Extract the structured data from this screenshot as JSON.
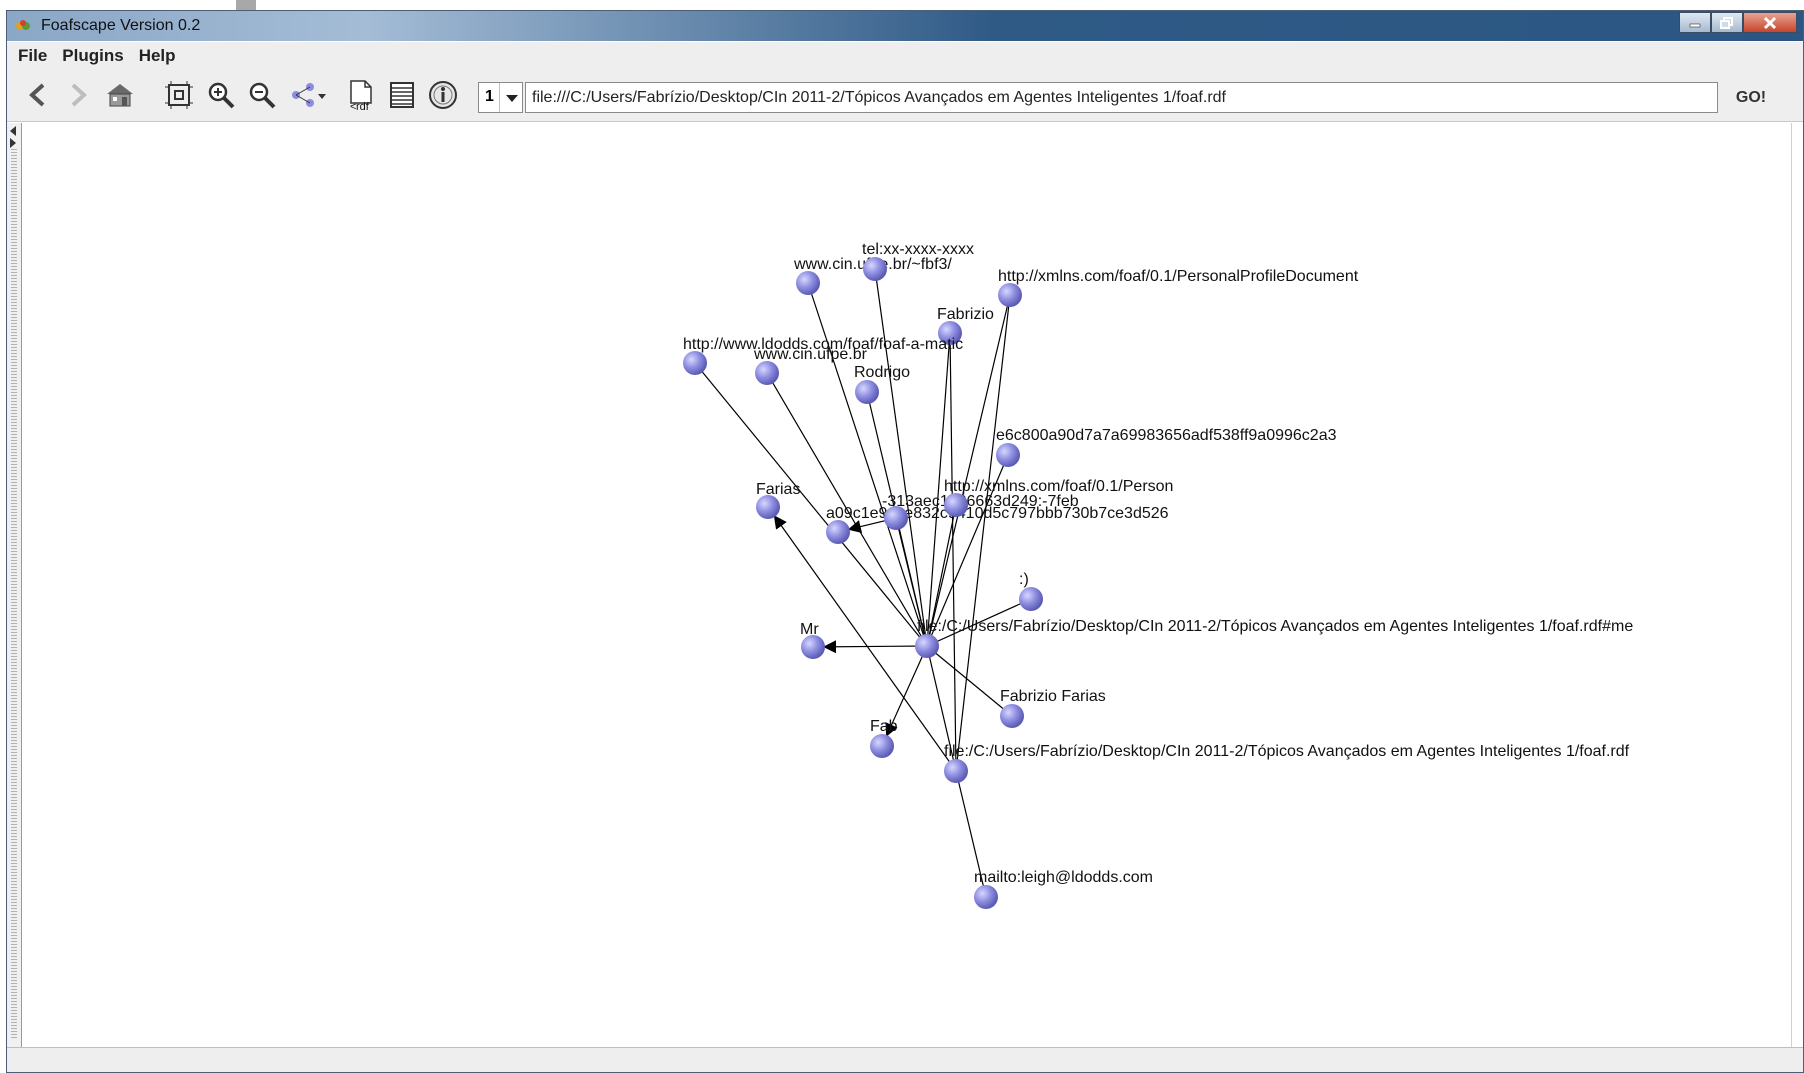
{
  "window": {
    "title": "Foafscape Version 0.2",
    "buttons": {
      "minimize": "minimize",
      "maximize": "maximize",
      "close": "close"
    }
  },
  "menu": {
    "items": [
      "File",
      "Plugins",
      "Help"
    ]
  },
  "toolbar": {
    "icons": [
      "back-arrow-icon",
      "forward-arrow-icon",
      "home-icon",
      "fit-view-icon",
      "zoom-in-icon",
      "zoom-out-icon",
      "layout-dropdown-icon",
      "rdf-document-icon",
      "table-view-icon",
      "info-icon"
    ],
    "page_number": "1",
    "url": "file:///C:/Users/Fabrízio/Desktop/CIn 2011-2/Tópicos Avançados em Agentes Inteligentes 1/foaf.rdf",
    "go_label": "GO!"
  },
  "graph": {
    "nodes": [
      {
        "id": "me",
        "label": "file:/C:/Users/Fabrízio/Desktop/CIn 2011-2/Tópicos Avançados em Agentes Inteligentes 1/foaf.rdf#me"
      },
      {
        "id": "homepage",
        "label": "www.cin.ufpe.br/~fbf3/"
      },
      {
        "id": "tel",
        "label": "tel:xx-xxxx-xxxx"
      },
      {
        "id": "pp",
        "label": "http://xmlns.com/foaf/0.1/PersonalProfileDocument"
      },
      {
        "id": "fabrizio",
        "label": "Fabrizio"
      },
      {
        "id": "maker",
        "label": "http://www.ldodds.com/foaf/foaf-a-matic"
      },
      {
        "id": "cin",
        "label": "www.cin.ufpe.br"
      },
      {
        "id": "rodrigo",
        "label": "Rodrigo"
      },
      {
        "id": "sha",
        "label": "e6c800a90d7a7a69983656adf538ff9a0996c2a3"
      },
      {
        "id": "farias",
        "label": "Farias"
      },
      {
        "id": "bnode1",
        "label": "a09c1e9dce832c9410d5c797bbb730b7ce3d526"
      },
      {
        "id": "bnode2",
        "label": "-313aec1386663d249:-7feb"
      },
      {
        "id": "person",
        "label": "http://xmlns.com/foaf/0.1/Person"
      },
      {
        "id": "smile",
        "label": ":)"
      },
      {
        "id": "mr",
        "label": "Mr"
      },
      {
        "id": "fullname",
        "label": "Fabrizio Farias"
      },
      {
        "id": "fab",
        "label": "Fab"
      },
      {
        "id": "doc",
        "label": "file:/C:/Users/Fabrízio/Desktop/CIn 2011-2/Tópicos Avançados em Agentes Inteligentes 1/foaf.rdf"
      },
      {
        "id": "mail",
        "label": "mailto:leigh@ldodds.com"
      }
    ],
    "node_color": "#8c8ce0"
  }
}
